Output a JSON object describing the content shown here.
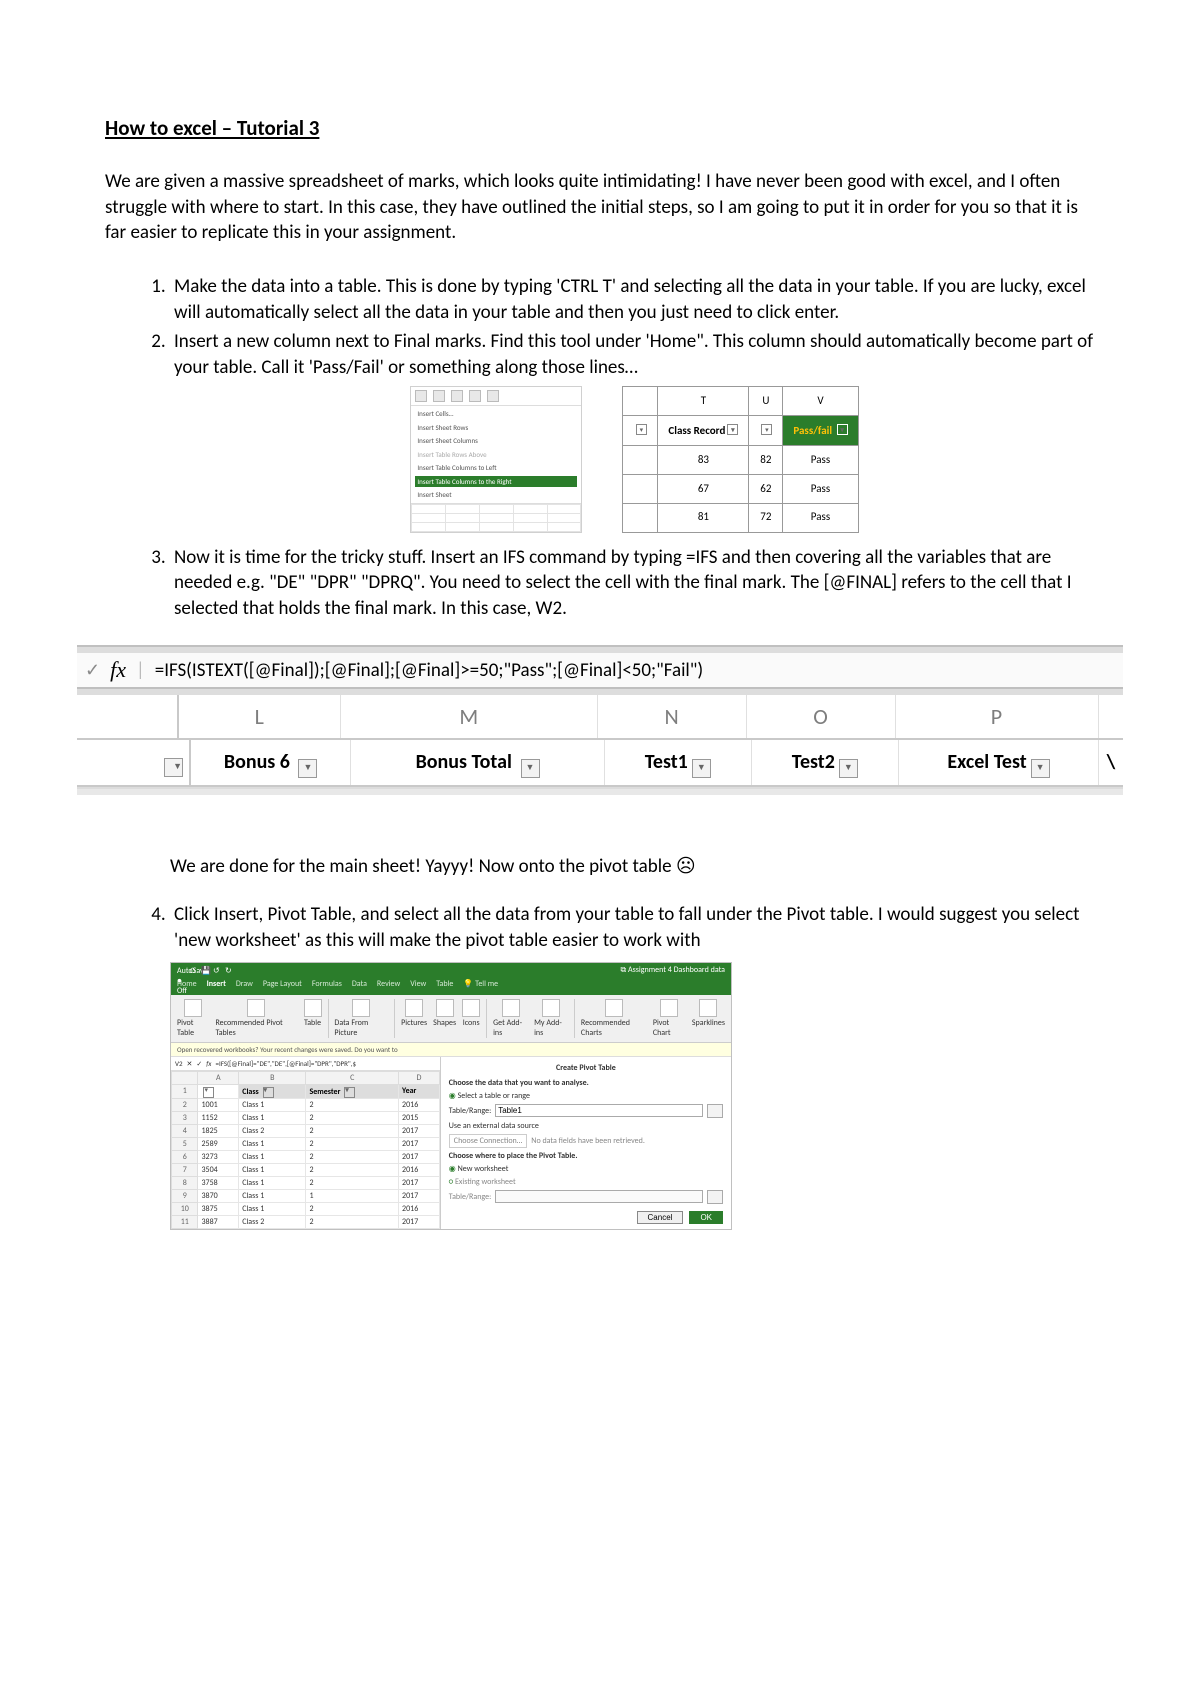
{
  "title": "How to excel – Tutorial 3",
  "intro": "We are given a massive spreadsheet of marks, which looks quite intimidating! I have never been good with excel, and I often struggle with where to start. In this case, they have outlined the initial steps, so I am going to put it in order for you so that it is far easier to replicate this in your assignment.",
  "steps": {
    "s1": "Make the data into a table. This is done by typing 'CTRL T' and selecting all the data in your table. If you are lucky, excel will automatically select all the data in your table and then you just need to click enter.",
    "s2": "Insert a new column next to Final marks. Find this tool under 'Home\". This column should automatically become part of your table. Call it 'Pass/Fail' or something along those lines…",
    "s3": "Now it is time for the tricky stuff. Insert an IFS command by typing =IFS and then covering all the variables that are needed e.g. \"DE\" \"DPR\" \"DPRQ\". You need to select the cell with the final mark. The [@FINAL] refers to the cell that I selected that holds the final mark. In this case, W2.",
    "s4": "Click Insert, Pivot Table, and select all the data from your table to fall under the Pivot table. I would suggest you select 'new worksheet' as this will make the pivot table easier to work with"
  },
  "ribbon_menu": {
    "cells": "Insert Cells…",
    "rows": "Insert Sheet Rows",
    "cols": "Insert Sheet Columns",
    "trows": "Insert Table Rows Above",
    "tleft": "Insert Table Columns to Left",
    "tright": "Insert Table Columns to the Right",
    "sheet": "Insert Sheet"
  },
  "minitable": {
    "hT": "T",
    "hU": "U",
    "hV": "V",
    "classRecord": "Class Record",
    "pfhdr": "Pass/fail",
    "rows": [
      {
        "t": "83",
        "u": "82",
        "v": "Pass"
      },
      {
        "t": "67",
        "u": "62",
        "v": "Pass"
      },
      {
        "t": "81",
        "u": "72",
        "v": "Pass"
      }
    ]
  },
  "fx": {
    "fxlabel": "fx",
    "formula": "=IFS(ISTEXT([@Final]);[@Final];[@Final]>=50;\"Pass\";[@Final]<50;\"Fail\")",
    "cols": [
      "L",
      "M",
      "N",
      "O",
      "P"
    ],
    "hdrs": [
      "Bonus 6",
      "Bonus Total",
      "Test1",
      "Test2",
      "Excel Test"
    ]
  },
  "after_fx": "We are done for the main sheet! Yayyy! Now onto the pivot table ☹",
  "pivot": {
    "autosave": "AutoSave ● Off",
    "wbname": "Assignment 4 Dashboard data",
    "tabs": [
      "Home",
      "Insert",
      "Draw",
      "Page Layout",
      "Formulas",
      "Data",
      "Review",
      "View",
      "Table"
    ],
    "tellme": "Tell me",
    "ribbon_items": [
      "Pivot Table",
      "Recommended Pivot Tables",
      "Table",
      "Data From Picture",
      "Pictures",
      "Shapes",
      "Icons",
      "Get Add-ins",
      "My Add-ins",
      "Recommended Charts",
      "Pivot Chart",
      "Sparklines"
    ],
    "recover_msg": "Open recovered workbooks?  Your recent changes were saved. Do you want to",
    "cellref": "V2",
    "fxline": "=IFS([@Final]=\"DE\",\"DE\",[@Final]=\"DPR\",\"DPR\",$",
    "grid_headers": [
      "",
      "A",
      "B",
      "C",
      "D"
    ],
    "grid_col_headers": [
      "",
      "",
      "Class",
      "Semester",
      "Year"
    ],
    "grid_rows": [
      [
        "1",
        "",
        "Class",
        "Semester",
        "Year"
      ],
      [
        "2",
        "1001",
        "Class 1",
        "2",
        "2016"
      ],
      [
        "3",
        "1152",
        "Class 1",
        "2",
        "2015"
      ],
      [
        "4",
        "1825",
        "Class 2",
        "2",
        "2017"
      ],
      [
        "5",
        "2589",
        "Class 1",
        "2",
        "2017"
      ],
      [
        "6",
        "3273",
        "Class 1",
        "2",
        "2017"
      ],
      [
        "7",
        "3504",
        "Class 1",
        "2",
        "2016"
      ],
      [
        "8",
        "3758",
        "Class 1",
        "2",
        "2017"
      ],
      [
        "9",
        "3870",
        "Class 1",
        "1",
        "2017"
      ],
      [
        "10",
        "3875",
        "Class 1",
        "2",
        "2016"
      ],
      [
        "11",
        "3887",
        "Class 2",
        "2",
        "2017"
      ]
    ],
    "dlg": {
      "title": "Create Pivot Table",
      "choose_data": "Choose the data that you want to analyse.",
      "sel_range": "Select a table or range",
      "table_range_lbl": "Table/Range:",
      "table_range_val": "Table1",
      "ext": "Use an external data source",
      "choose_conn": "Choose Connection…",
      "no_fields": "No data fields have been retrieved.",
      "where": "Choose where to place the Pivot Table.",
      "newws": "New worksheet",
      "exws": "Existing worksheet",
      "tr2": "Table/Range:",
      "cancel": "Cancel",
      "ok": "OK"
    }
  }
}
